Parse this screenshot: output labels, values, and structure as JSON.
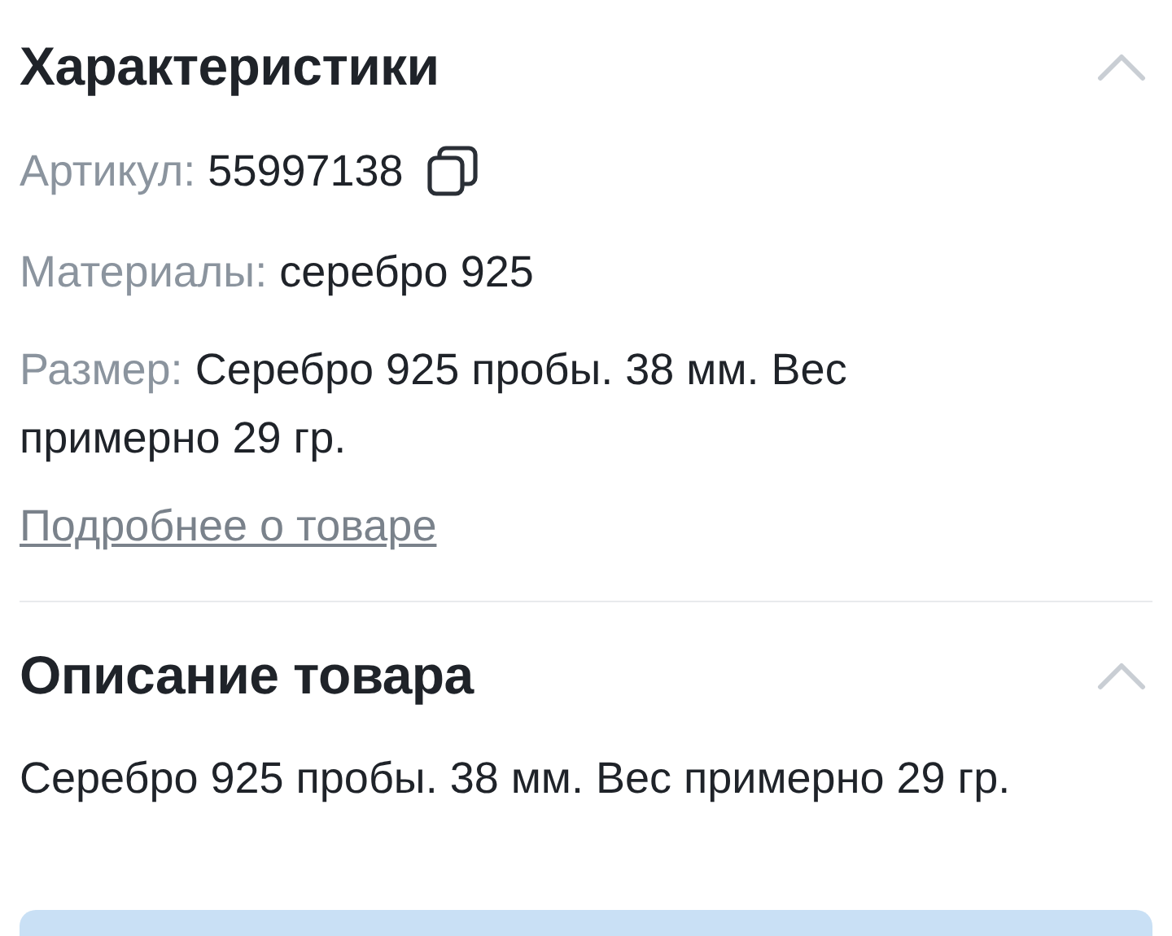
{
  "sections": [
    {
      "title": "Характеристики",
      "expanded": true,
      "properties": [
        {
          "label": "Артикул:",
          "value": "55997138",
          "kind": "copyable"
        },
        {
          "label": "Материалы:",
          "value": "серебро 925",
          "kind": "plain"
        },
        {
          "label": "Размер:",
          "value": "Серебро 925 пробы. 38 мм. Вес примерно 29 гр.",
          "kind": "plain"
        }
      ],
      "link": "Подробнее о товаре"
    },
    {
      "title": "Описание товара",
      "expanded": true,
      "text": "Серебро 925 пробы. 38 мм. Вес примерно 29 гр."
    }
  ]
}
